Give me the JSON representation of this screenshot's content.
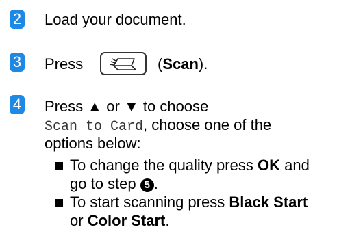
{
  "steps": [
    {
      "number": "2",
      "text": "Load your document."
    },
    {
      "number": "3",
      "prefix": "Press",
      "key_icon": "scanner-icon",
      "open_paren": "(",
      "key_label": "Scan",
      "close_paren": ")."
    },
    {
      "number": "4",
      "line1_press": "Press",
      "up_arrow": "▲",
      "or": "or",
      "down_arrow": "▼",
      "line1_tail": "to choose",
      "menu_item": "Scan to Card",
      "line2_tail": ", choose one of the",
      "line3": "options below:"
    }
  ],
  "bullets": [
    {
      "line1_text": "To change the quality press",
      "line1_bold": "OK",
      "line1_tail": "and",
      "line2_text": "go to step",
      "step_ref": "5",
      "line2_tail": "."
    },
    {
      "line1_text": "To start scanning press",
      "line1_bold": "Black Start",
      "line2_bold": "Color Start",
      "or": "or",
      "line2_tail": "."
    }
  ],
  "colors": {
    "badge_background": "#1e88e5",
    "badge_text": "#ffffff"
  }
}
